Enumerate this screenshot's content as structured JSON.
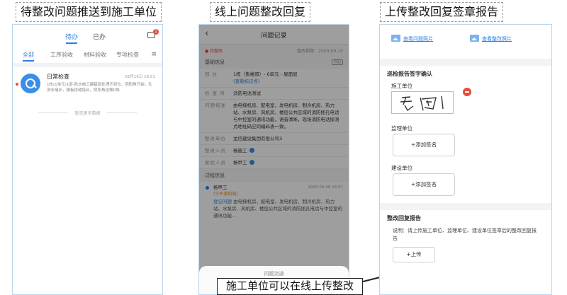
{
  "captions": {
    "left": "待整改问题推送到施工单位",
    "middle": "线上问题整改回复",
    "right": "上传整改回复签章报告",
    "callout": "施工单位可以在线上传整改"
  },
  "phone1": {
    "tabs": {
      "todo": "待办",
      "done": "已办"
    },
    "badge_count": "1",
    "filters": {
      "all": "全部",
      "f1": "工序验收",
      "f2": "材料验收",
      "f3": "专项检查",
      "menu_icon": "≡"
    },
    "card": {
      "title": "日常检查",
      "date": "02月16日 18:51",
      "desc": "1栋(1单元)1层-防水施工翻基层处理不到位，阴阳角开裂，孔洞未堵补，模板拼缝错台，阴阳角没做R角"
    },
    "no_more": "暂无更多数据"
  },
  "phone2": {
    "back": "‹",
    "title": "问题记录",
    "status": "● 待整改",
    "deadline": "整改期限：2020-09-15",
    "basic_section": "基础信息",
    "fold": "收起",
    "rows": {
      "location_label": "部    位",
      "location_value": "1栋（售楼部）- 6单元 - 屋面层",
      "location_link": "(查看标记点)",
      "item_label": "检 查 项",
      "item_value": "消防电话测试",
      "desc_label": "问题描述",
      "desc_value": "由电梯机房、配电室、发电机房、制冷机房、热力站、水泵房、风机房、楼层公共区域的消防插孔电话与中控室的通讯功能，语音清晰，现场消防电话探测点地址码应同编码表一致。",
      "unit_label": "整改单位",
      "unit_value": "龙信建设集团有限公司3",
      "person_label": "整改人员",
      "person_value": "杨施工",
      "reviewer_label": "复验人员",
      "reviewer_value": "杨甲工"
    },
    "process_section": "过程信息",
    "step": {
      "who": "杨甲工",
      "time": "2020-09-08 16:51",
      "sub": "(宁乡美的城)",
      "note_tag": "登记问题",
      "note": "由电梯机房、配电室、发电机房、制冷机房、热力站、水泵房、风机房、楼层公共区域的消防插孔电话与中控室的通讯功能..."
    },
    "sheet_title": "问题流通"
  },
  "phone3": {
    "view_problem_photo": "查看问题照片",
    "view_rectify_photo": "查看整改照片",
    "sign_section": "巡检报告签字确认",
    "construction_label": "施工单位",
    "supervision_label": "监理单位",
    "owner_label": "建设单位",
    "add_signature": "+添加签名",
    "report_section": "整改回复报告",
    "report_note": "说明：请上传施工单位、监理单位、建设单位签章后的整改回复报告",
    "upload": "+上传"
  }
}
